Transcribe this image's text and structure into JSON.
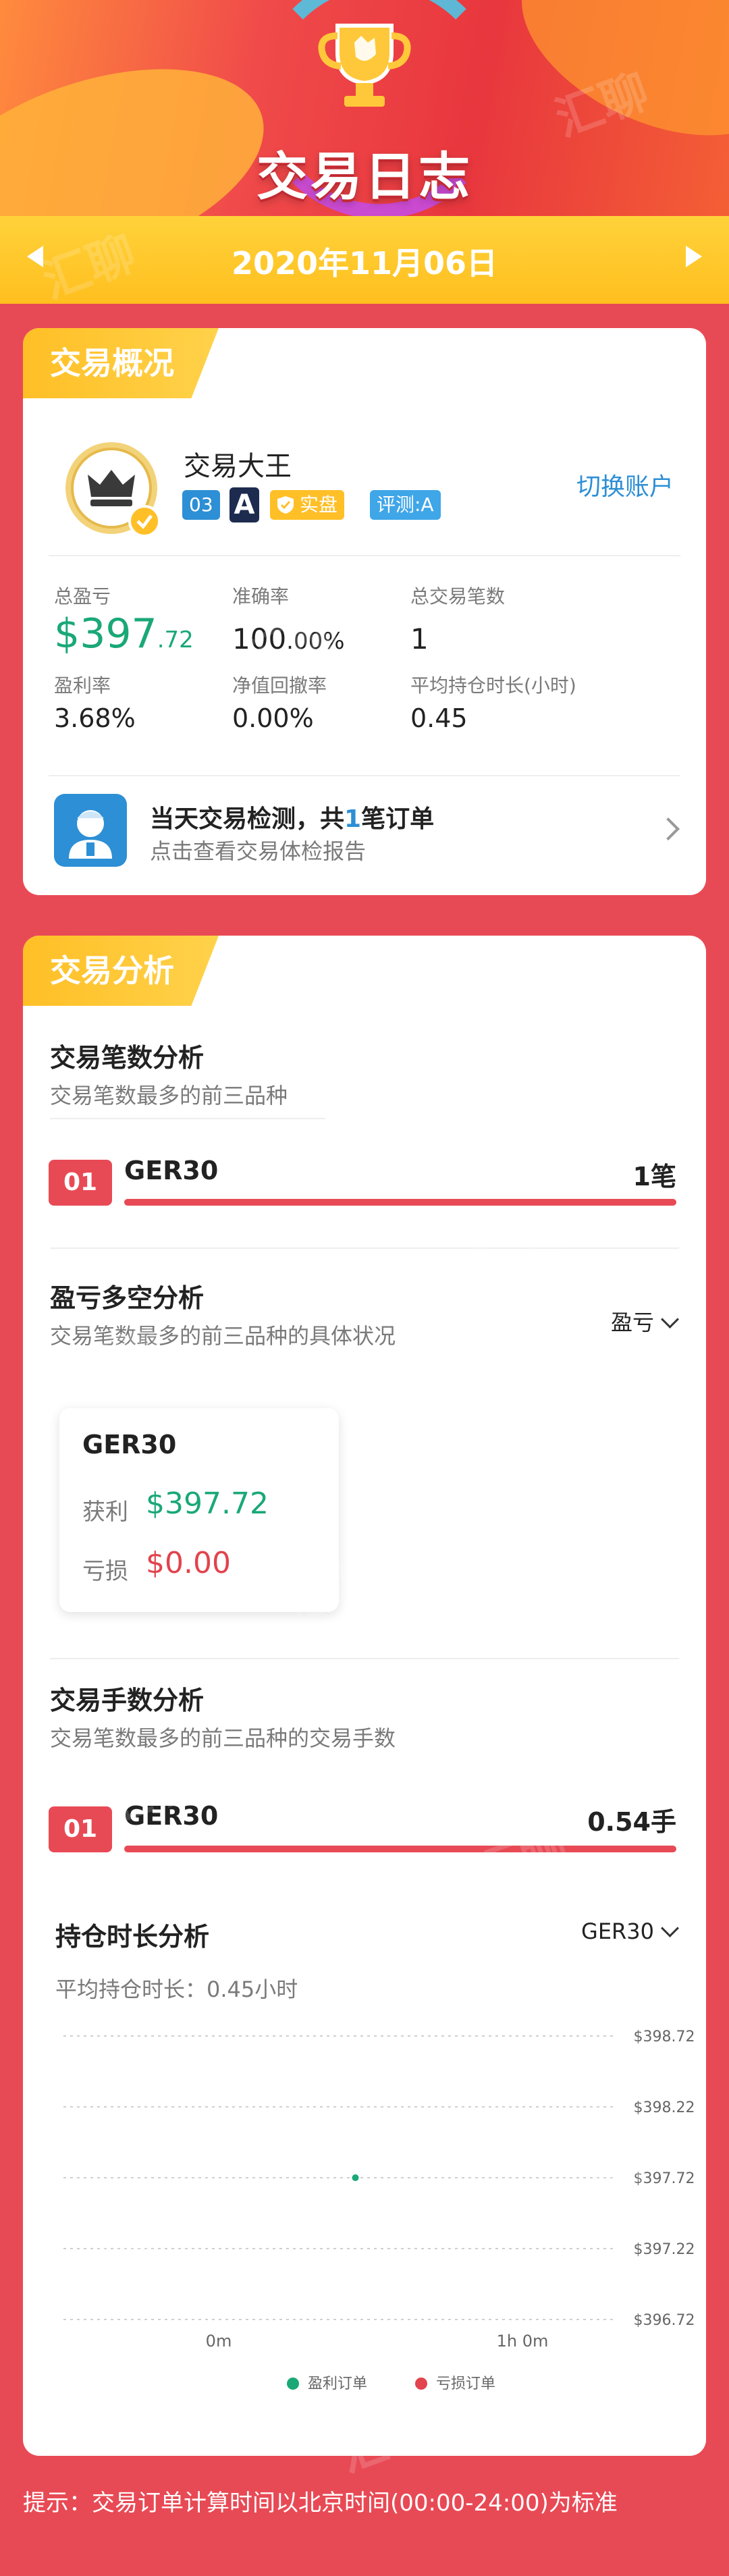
{
  "banner": {
    "title": "交易日志"
  },
  "date_bar": {
    "date": "2020年11月06日"
  },
  "overview": {
    "tag": "交易概况",
    "account_name": "交易大王",
    "switch_label": "切换账户",
    "badges": {
      "level": "03",
      "broker_letter": "A",
      "real": "实盘",
      "rating": "评测:A"
    },
    "stats": [
      {
        "label": "总盈亏",
        "value_prefix": "$",
        "value_main": "397",
        "value_decimal": ".72"
      },
      {
        "label": "准确率",
        "value_main": "100",
        "value_decimal": ".00%"
      },
      {
        "label": "总交易笔数",
        "value_main": "1"
      },
      {
        "label": "盈利率",
        "value_main": "3.68%"
      },
      {
        "label": "净值回撤率",
        "value_main": "0.00%"
      },
      {
        "label": "平均持仓时长(小时)",
        "value_main": "0.45"
      }
    ],
    "check": {
      "title_prefix": "当天交易检测，共",
      "count": "1",
      "title_suffix": "笔订单",
      "subtitle": "点击查看交易体检报告"
    }
  },
  "analysis": {
    "tag": "交易分析",
    "count_section": {
      "title": "交易笔数分析",
      "subtitle": "交易笔数最多的前三品种",
      "items": [
        {
          "rank": "01",
          "symbol": "GER30",
          "value": "1笔",
          "fill": 1.0
        }
      ]
    },
    "pnl_section": {
      "title": "盈亏多空分析",
      "subtitle": "交易笔数最多的前三品种的具体状况",
      "dropdown": "盈亏",
      "card": {
        "symbol": "GER30",
        "profit_label": "获利",
        "profit_value": "$397.72",
        "loss_label": "亏损",
        "loss_value": "$0.00"
      }
    },
    "lots_section": {
      "title": "交易手数分析",
      "subtitle": "交易笔数最多的前三品种的交易手数",
      "items": [
        {
          "rank": "01",
          "symbol": "GER30",
          "value": "0.54手",
          "fill": 1.0
        }
      ]
    },
    "hold_section": {
      "title": "持仓时长分析",
      "dropdown": "GER30",
      "avg_label": "平均持仓时长：",
      "avg_value": "0.45小时"
    }
  },
  "chart_data": {
    "type": "scatter",
    "x_ticks": [
      "0m",
      "1h 0m"
    ],
    "y_ticks": [
      "$398.72",
      "$398.22",
      "$397.72",
      "$397.22",
      "$396.72"
    ],
    "ylim": [
      396.72,
      398.72
    ],
    "xlim_hours": [
      0,
      1
    ],
    "series": [
      {
        "name": "盈利订单",
        "color": "#1aa877",
        "points": [
          {
            "x_hours": 0.45,
            "y": 397.72
          }
        ]
      },
      {
        "name": "亏损订单",
        "color": "#e2434d",
        "points": []
      }
    ]
  },
  "footer": {
    "tip": "提示：交易订单计算时间以北京时间(00:00-24:00)为标准"
  },
  "watermark": "汇聊",
  "colors": {
    "page_bg": "#e84a55",
    "accent_yellow": "#ffc229",
    "profit": "#1aa877",
    "loss": "#e2434d",
    "link": "#2d8fd5"
  }
}
